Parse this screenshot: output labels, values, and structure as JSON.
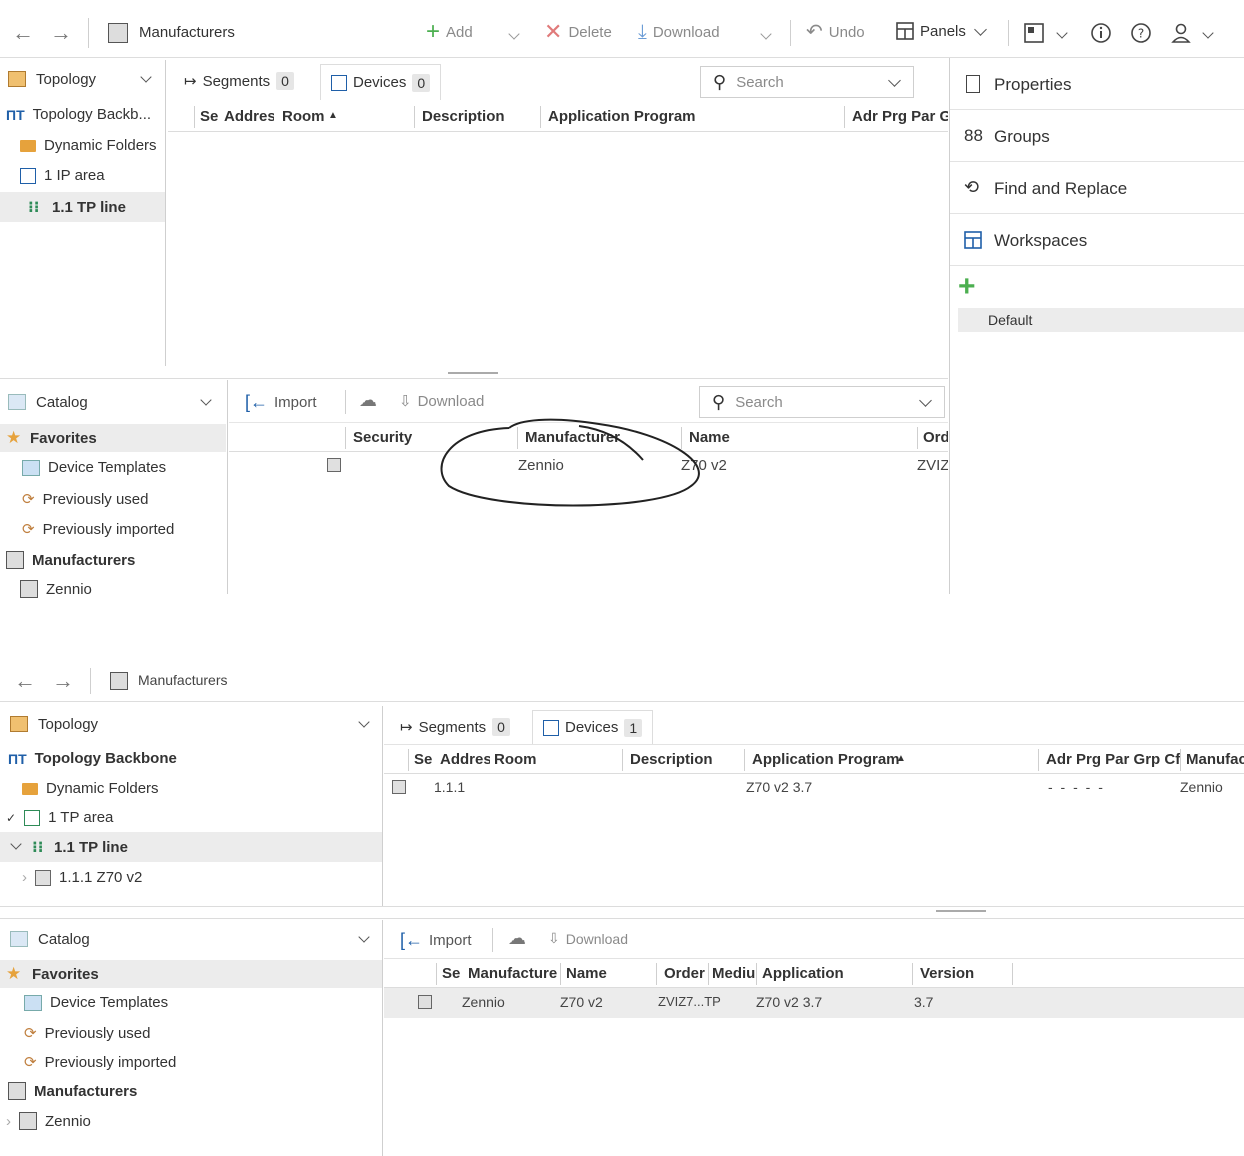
{
  "top": {
    "titlebar": {
      "title": "Manufacturers"
    },
    "toolbar": {
      "add": "Add",
      "delete": "Delete",
      "download": "Download",
      "undo": "Undo",
      "panels": "Panels"
    },
    "left_tree": {
      "header": "Topology",
      "items": [
        "Topology Backb...",
        "Dynamic Folders",
        "1 IP area",
        "1.1 TP line"
      ]
    },
    "tabs": {
      "segments": "Segments",
      "segments_count": "0",
      "devices": "Devices",
      "devices_count": "0"
    },
    "search_placeholder": "Search",
    "columns": [
      "Se",
      "Addres",
      "Room",
      "Description",
      "Application Program",
      "Adr Prg Par G"
    ],
    "right_panel": {
      "properties": "Properties",
      "groups": "Groups",
      "find_replace": "Find and Replace",
      "workspaces": "Workspaces",
      "workspace_default": "Default"
    },
    "catalog": {
      "header": "Catalog",
      "items": [
        "Favorites",
        "Device Templates",
        "Previously used",
        "Previously imported",
        "Manufacturers",
        "Zennio"
      ]
    },
    "catalog_toolbar": {
      "import": "Import",
      "download": "Download",
      "search": "Search"
    },
    "catalog_columns": [
      "Security",
      "Manufacturer",
      "Name",
      "Ord"
    ],
    "catalog_row": {
      "manufacturer": "Zennio",
      "name": "Z70 v2",
      "order": "ZVIZ"
    }
  },
  "bottom": {
    "titlebar": {
      "title": "Manufacturers"
    },
    "left_tree": {
      "header": "Topology",
      "items": [
        "Topology Backbone",
        "Dynamic Folders",
        "1 TP area",
        "1.1 TP line",
        "1.1.1 Z70 v2"
      ]
    },
    "tabs": {
      "segments": "Segments",
      "segments_count": "0",
      "devices": "Devices",
      "devices_count": "1"
    },
    "columns": [
      "Se",
      "Addres",
      "Room",
      "Description",
      "Application Program",
      "Adr Prg Par Grp Cfg",
      "Manufac"
    ],
    "device_row": {
      "address": "1.1.1",
      "app": "Z70 v2 3.7",
      "flags": "- - - - -",
      "manufacturer": "Zennio"
    },
    "catalog": {
      "header": "Catalog",
      "items": [
        "Favorites",
        "Device Templates",
        "Previously used",
        "Previously imported",
        "Manufacturers",
        "Zennio"
      ]
    },
    "catalog_toolbar": {
      "import": "Import",
      "download": "Download"
    },
    "catalog_columns": [
      "Se",
      "Manufacturer",
      "Name",
      "Order",
      "Mediu",
      "Application",
      "Version"
    ],
    "catalog_row": {
      "manufacturer": "Zennio",
      "name": "Z70 v2",
      "order": "ZVIZ7...TP",
      "application": "Z70 v2 3.7",
      "version": "3.7"
    }
  },
  "colors": {
    "accent": "#1f5fa8",
    "add_green": "#4caf50",
    "delete_red": "#d9534f",
    "folder": "#e6a23c",
    "line_green": "#2e8b57"
  }
}
